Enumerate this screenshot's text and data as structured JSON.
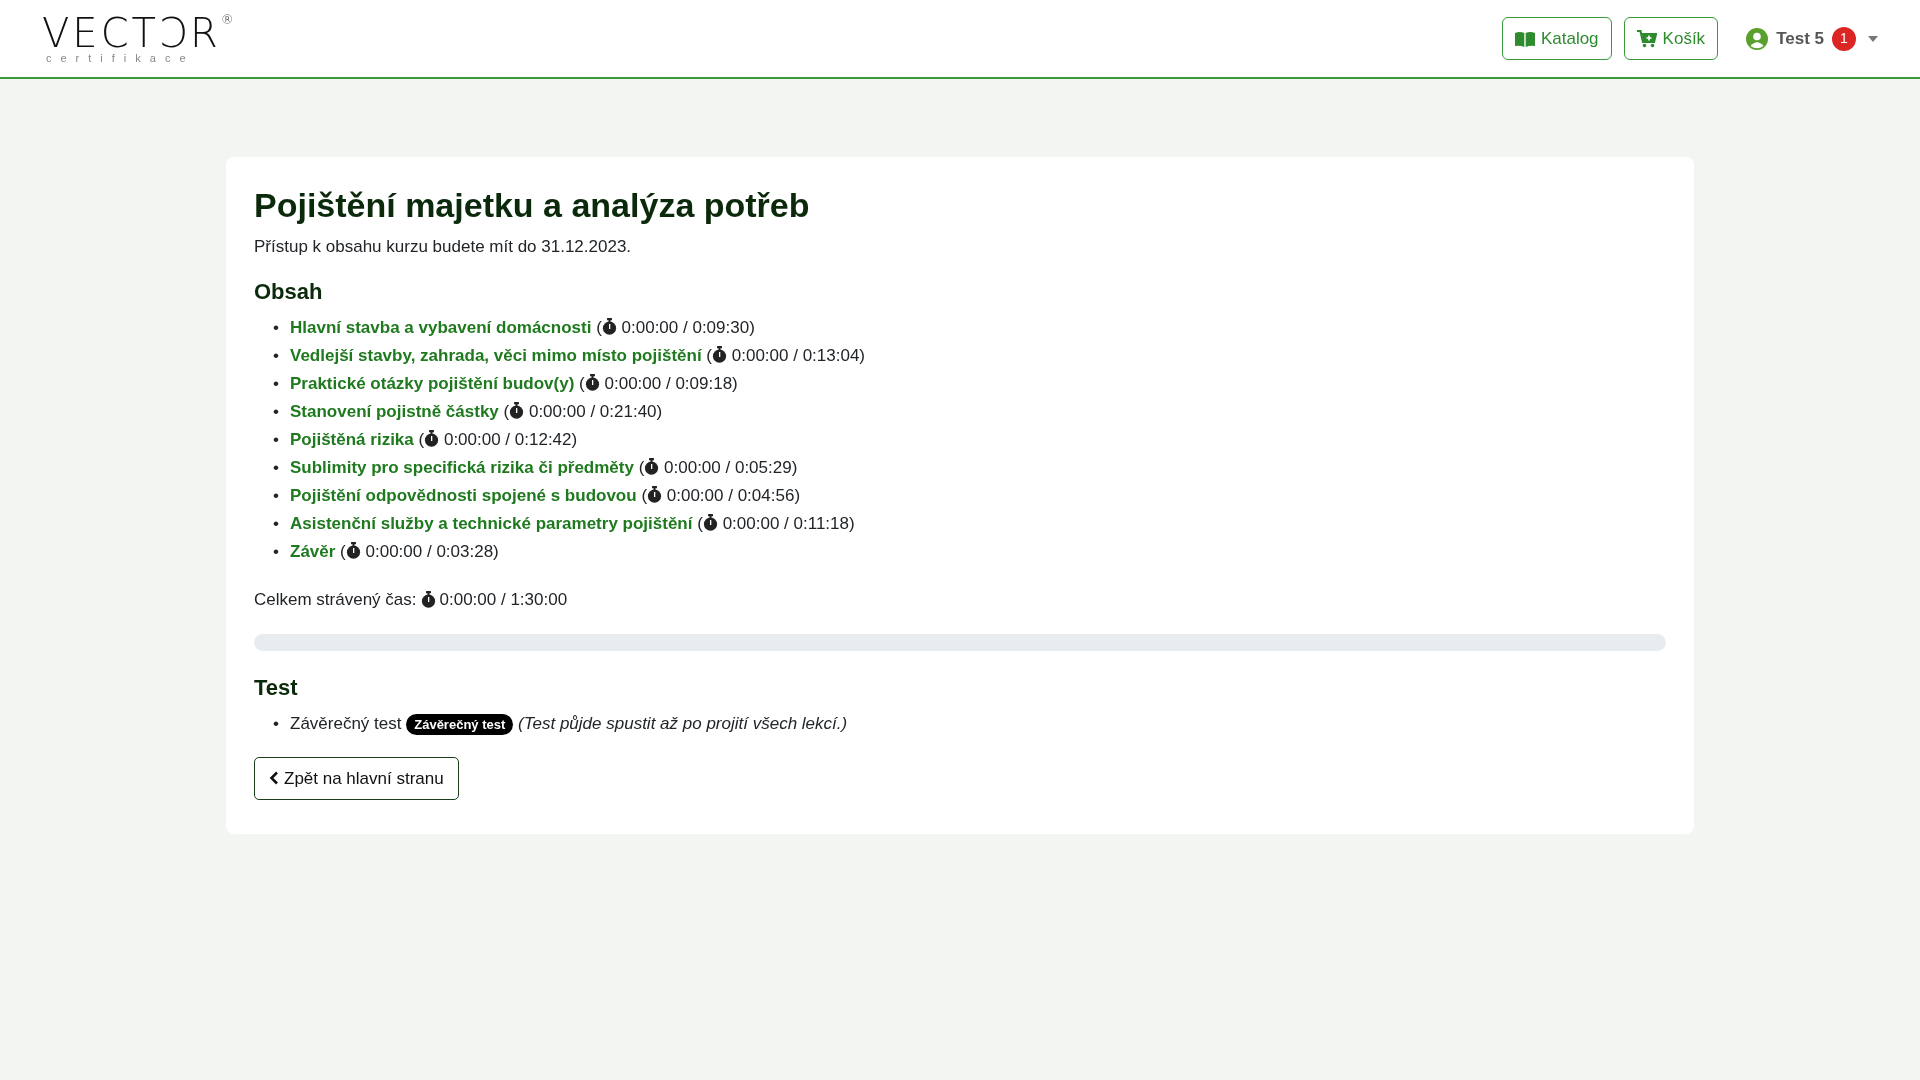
{
  "logo": {
    "word": "VECTƆR",
    "registered": "®",
    "subtitle": "certifikace"
  },
  "nav": {
    "buttons": [
      {
        "kind": "book",
        "label": "Katalog"
      },
      {
        "kind": "cart",
        "label": "Košík"
      }
    ],
    "user": {
      "name": "Test 5",
      "badge": "1"
    }
  },
  "course": {
    "title": "Pojištění majetku a analýza potřeb",
    "access": "Přístup k obsahu kurzu budete mít do 31.12.2023.",
    "contents_heading": "Obsah",
    "bullet": "•",
    "lessons": [
      {
        "title": "Hlavní stavba a vybavení domácnosti",
        "open": "(",
        "time": "0:00:00 / 0:09:30)"
      },
      {
        "title": "Vedlejší stavby, zahrada, věci mimo místo pojištění",
        "open": "(",
        "time": "0:00:00 / 0:13:04)"
      },
      {
        "title": "Praktické otázky pojištění budov(y)",
        "open": "(",
        "time": "0:00:00 / 0:09:18)"
      },
      {
        "title": "Stanovení pojistně částky",
        "open": "(",
        "time": "0:00:00 / 0:21:40)"
      },
      {
        "title": "Pojištěná rizika",
        "open": "(",
        "time": "0:00:00 / 0:12:42)"
      },
      {
        "title": "Sublimity pro specifická rizika či předměty",
        "open": "(",
        "time": "0:00:00 / 0:05:29)"
      },
      {
        "title": "Pojištění odpovědnosti spojené s budovou",
        "open": "(",
        "time": "0:00:00 / 0:04:56)"
      },
      {
        "title": "Asistenční služby a technické parametry pojištění",
        "open": "(",
        "time": "0:00:00 / 0:11:18)"
      },
      {
        "title": "Závěr",
        "open": "(",
        "time": "0:00:00 / 0:03:28)"
      }
    ],
    "total_label": "Celkem strávený čas:",
    "total_time": "0:00:00 / 1:30:00",
    "progress": {
      "level": 0
    },
    "test_heading": "Test",
    "tests": [
      {
        "name": "Závěrečný test",
        "badge": "Závěrečný test",
        "note": "(Test půjde spustit až po projití všech lekcí.)"
      }
    ],
    "back_button": "Zpět na hlavní stranu"
  }
}
